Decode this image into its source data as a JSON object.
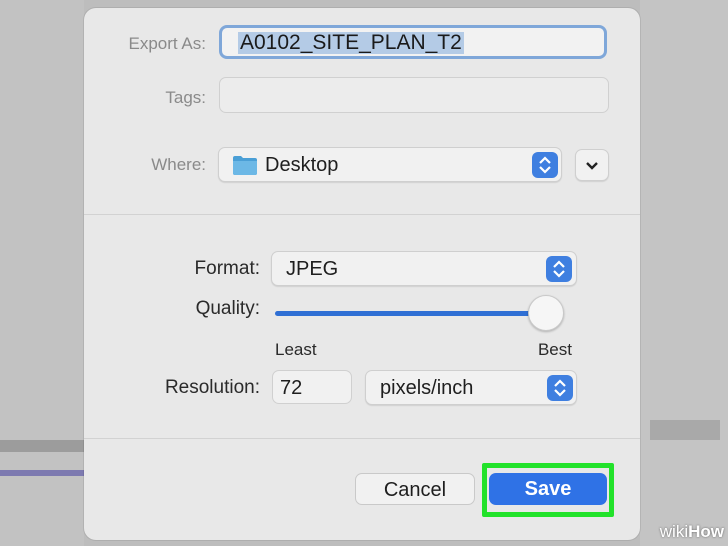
{
  "dialog": {
    "export_as_label": "Export As:",
    "file_name": "A0102_SITE_PLAN_T2",
    "tags_label": "Tags:",
    "tags_value": "",
    "where_label": "Where:",
    "where_value": "Desktop",
    "format_label": "Format:",
    "format_value": "JPEG",
    "quality_label": "Quality:",
    "quality_level": 1.0,
    "quality_min_label": "Least",
    "quality_max_label": "Best",
    "resolution_label": "Resolution:",
    "resolution_value": "72",
    "resolution_unit": "pixels/inch",
    "cancel_label": "Cancel",
    "save_label": "Save"
  },
  "watermark": {
    "prefix": "wiki",
    "suffix": "How"
  },
  "colors": {
    "accent": "#2f72e6",
    "highlight": "#22e22a",
    "folder": "#4a9fd6"
  },
  "icons": [
    "folder-icon",
    "up-down-chevron-icon",
    "chevron-down-icon"
  ]
}
